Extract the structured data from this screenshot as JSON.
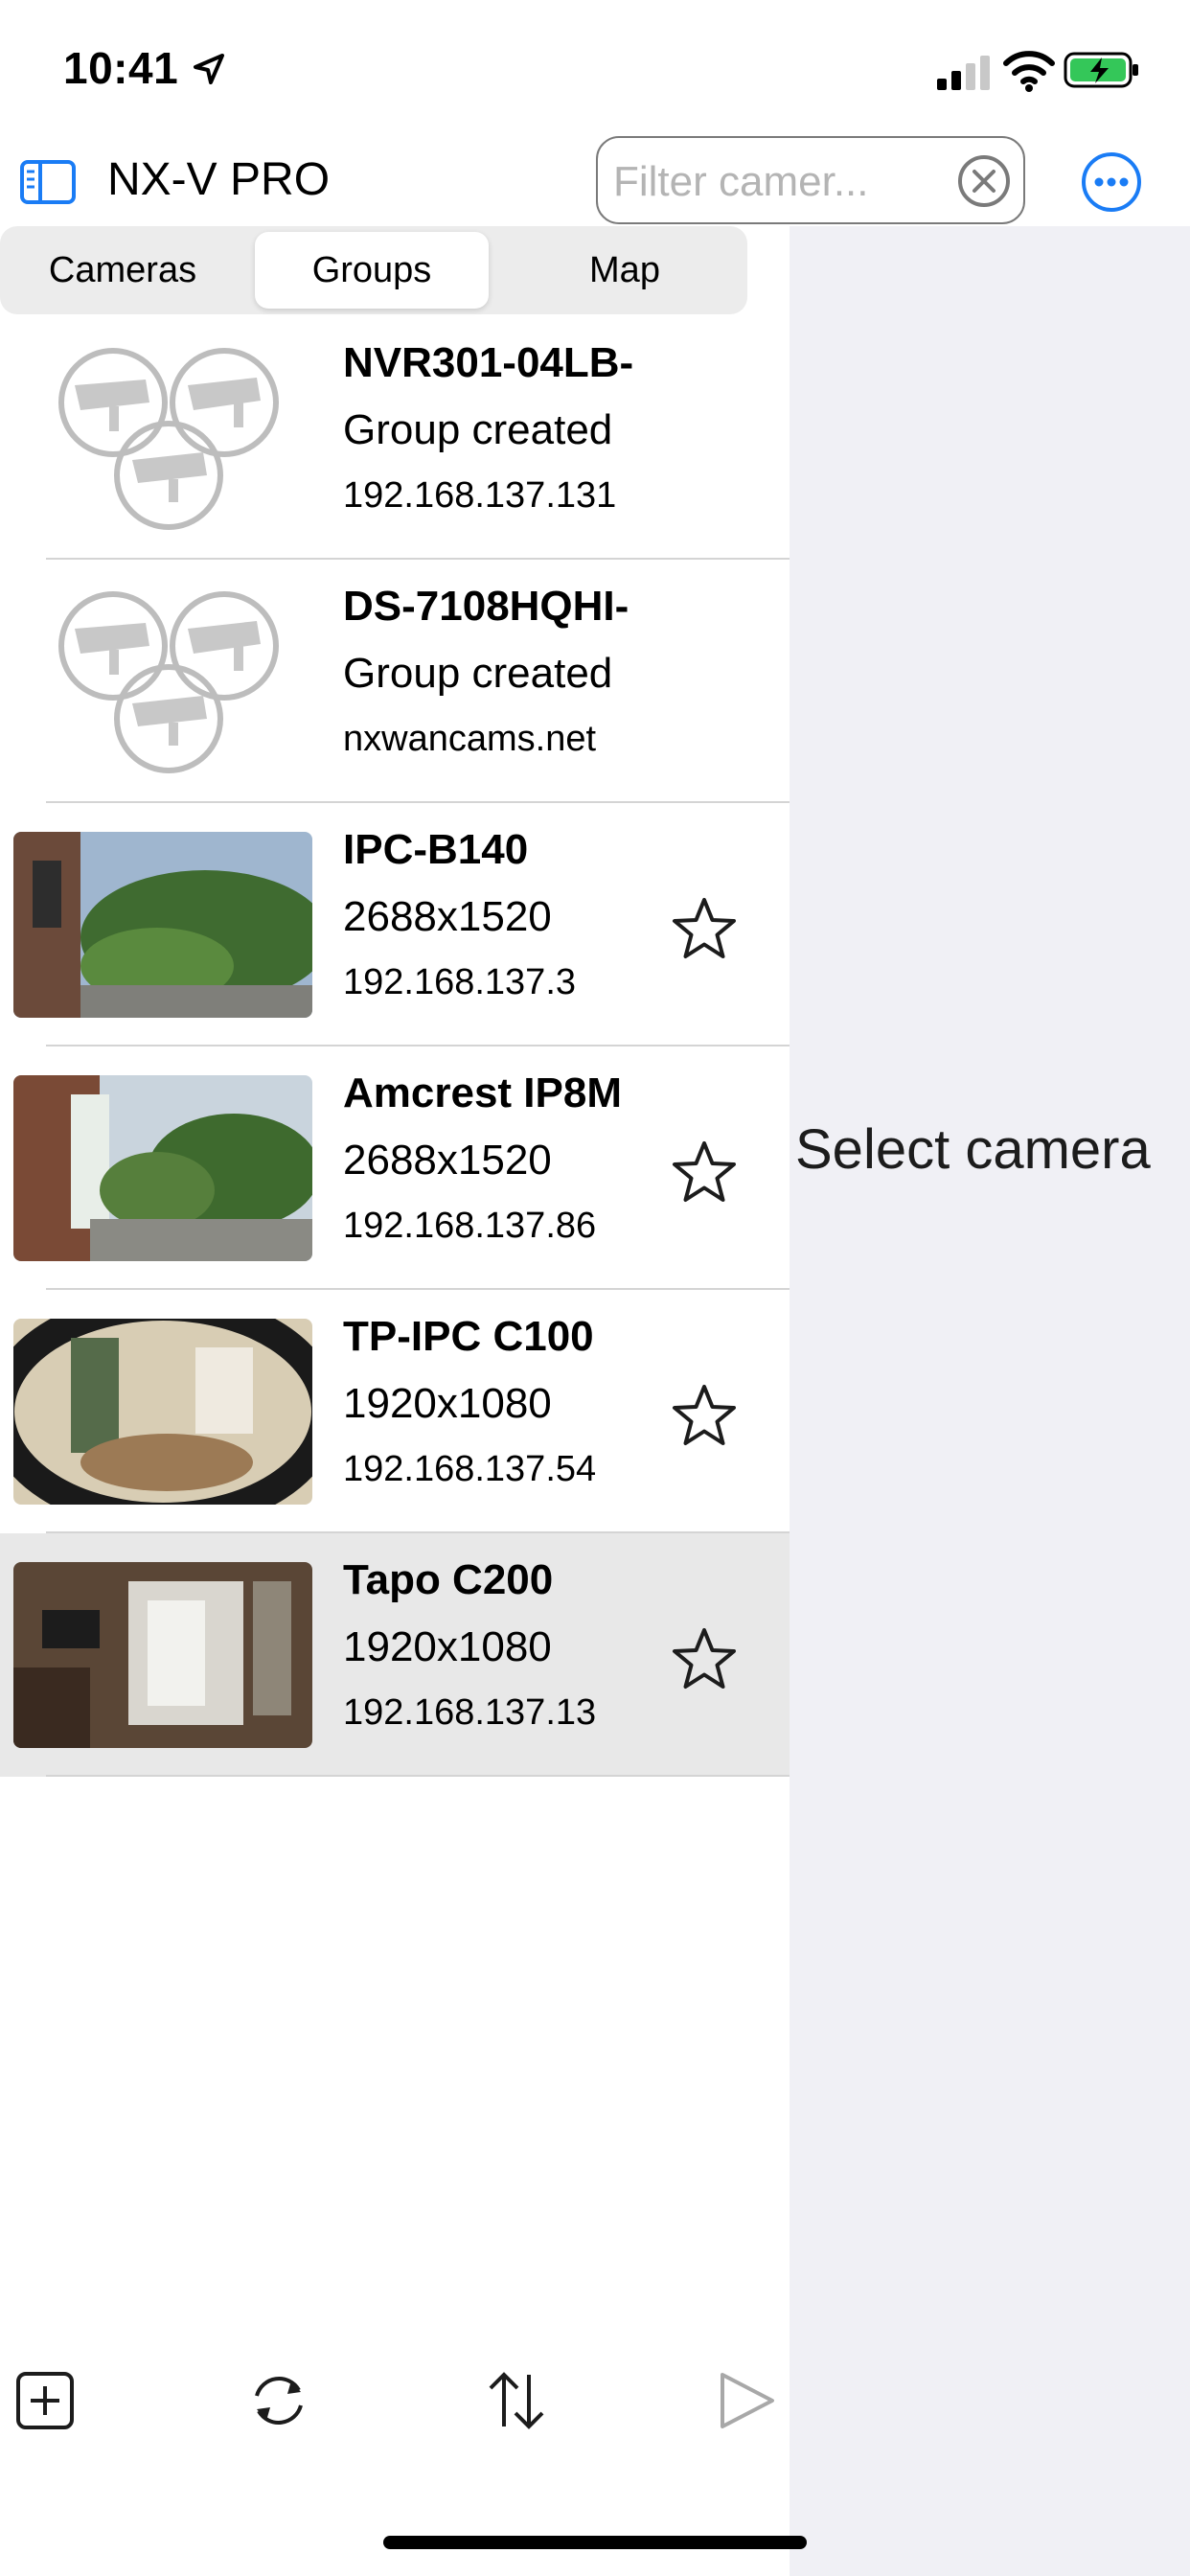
{
  "status_bar": {
    "time": "10:41"
  },
  "nav": {
    "title": "NX-V PRO",
    "filter_placeholder": "Filter camer...",
    "filter_value": ""
  },
  "segments": [
    {
      "label": "Cameras",
      "active": false
    },
    {
      "label": "Groups",
      "active": true
    },
    {
      "label": "Map",
      "active": false
    }
  ],
  "rows": [
    {
      "kind": "group",
      "title": "NVR301-04LB-",
      "subtitle": "Group created",
      "address": "192.168.137.131"
    },
    {
      "kind": "group",
      "title": "DS-7108HQHI-",
      "subtitle": "Group created",
      "address": "nxwancams.net"
    },
    {
      "kind": "camera",
      "title": "IPC-B140",
      "subtitle": "2688x1520",
      "address": "192.168.137.3",
      "thumb": "garden-hedge",
      "thumb_overlay": ""
    },
    {
      "kind": "camera",
      "title": "Amcrest IP8M",
      "subtitle": "2688x1520",
      "address": "192.168.137.86",
      "thumb": "garden-path",
      "thumb_overlay": ""
    },
    {
      "kind": "camera",
      "title": "TP-IPC C100",
      "subtitle": "1920x1080",
      "address": "192.168.137.54",
      "thumb": "hallway",
      "thumb_overlay": ""
    },
    {
      "kind": "camera",
      "title": "Tapo C200",
      "subtitle": "1920x1080",
      "address": "192.168.137.13",
      "thumb": "living-room",
      "thumb_overlay": "",
      "selected": true
    }
  ],
  "detail": {
    "placeholder": "Select camera"
  },
  "toolbar": [
    "add-icon",
    "refresh-icon",
    "sort-icon",
    "play-icon"
  ],
  "colors": {
    "accent": "#1a7cf5",
    "detail_bg": "#f0f0f5",
    "selected_row": "#e8e8e8"
  }
}
